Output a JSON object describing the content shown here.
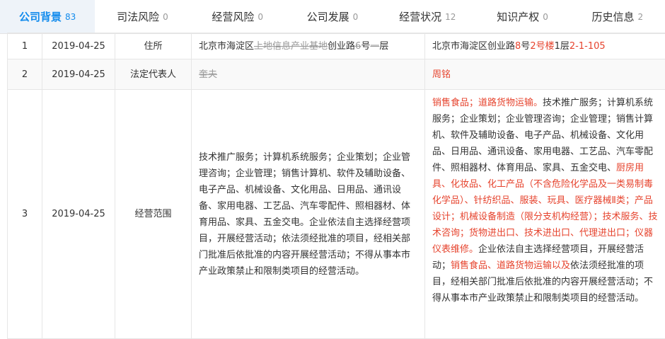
{
  "tabs": [
    {
      "label": "公司背景",
      "count": "83",
      "active": true
    },
    {
      "label": "司法风险",
      "count": "0"
    },
    {
      "label": "经营风险",
      "count": "0"
    },
    {
      "label": "公司发展",
      "count": "0"
    },
    {
      "label": "经营状况",
      "count": "12"
    },
    {
      "label": "知识产权",
      "count": "0"
    },
    {
      "label": "历史信息",
      "count": "2"
    }
  ],
  "rows": [
    {
      "index": "1",
      "date": "2019-04-25",
      "item": "住所",
      "before": [
        {
          "t": "北京市海淀区"
        },
        {
          "t": "上地信息产业基地",
          "s": "del"
        },
        {
          "t": "创业路"
        },
        {
          "t": "6",
          "s": "del"
        },
        {
          "t": "号"
        },
        {
          "t": "一",
          "s": "del"
        },
        {
          "t": "层"
        }
      ],
      "after": [
        {
          "t": "北京市海淀区创业路"
        },
        {
          "t": "8",
          "s": "red"
        },
        {
          "t": "号"
        },
        {
          "t": "2号楼",
          "s": "red"
        },
        {
          "t": "1"
        },
        {
          "t": "层"
        },
        {
          "t": "2-1-105",
          "s": "red"
        }
      ]
    },
    {
      "index": "2",
      "date": "2019-04-25",
      "item": "法定代表人",
      "before": [
        {
          "t": "奎夫",
          "s": "del"
        }
      ],
      "after": [
        {
          "t": "周铭",
          "s": "red"
        }
      ]
    },
    {
      "index": "3",
      "date": "2019-04-25",
      "item": "经营范围",
      "before": [
        {
          "t": "技术推广服务；计算机系统服务；企业策划；企业管理咨询；企业管理；销售计算机、软件及辅助设备、电子产品、机械设备、文化用品、日用品、通讯设备、家用电器、工艺品、汽车零配件、照相器材、体育用品、家具、五金交电。企业依法自主选择经营项目，开展经营活动；依法须经批准的项目，经相关部门批准后依批准的内容开展经营活动；不得从事本市产业政策禁止和限制类项目的经营活动。"
        }
      ],
      "after": [
        {
          "t": "销售食品；道路货物运输。",
          "s": "red"
        },
        {
          "t": "技术推广服务；计算机系统服务；企业策划；企业管理咨询；企业管理；销售计算机、软件及辅助设备、电子产品、机械设备、文化用品、日用品、通讯设备、家用电器、工艺品、汽车零配件、照相器材、体育用品、家具、五金交电、"
        },
        {
          "t": "厨房用具、化妆品、化工产品（不含危险化学品及一类易制毒化学品）、针纺织品、服装、玩具、医疗器械Ⅱ类；产品设计；机械设备制造（限分支机构经营）；技术服务、技术咨询；货物进出口、技术进出口、代理进出口；仪器仪表维修。",
          "s": "red"
        },
        {
          "t": "企业依法自主选择经营项目，开展经营活动；"
        },
        {
          "t": "销售食品、道路货物运输以及",
          "s": "red"
        },
        {
          "t": "依法须经批准的项目，经相关部门批准后依批准的内容开展经营活动；不得从事本市产业政策禁止和限制类项目的经营活动。"
        }
      ]
    }
  ],
  "colors": {
    "accent": "#128bed",
    "added": "#e6432d",
    "removed": "#999999"
  }
}
